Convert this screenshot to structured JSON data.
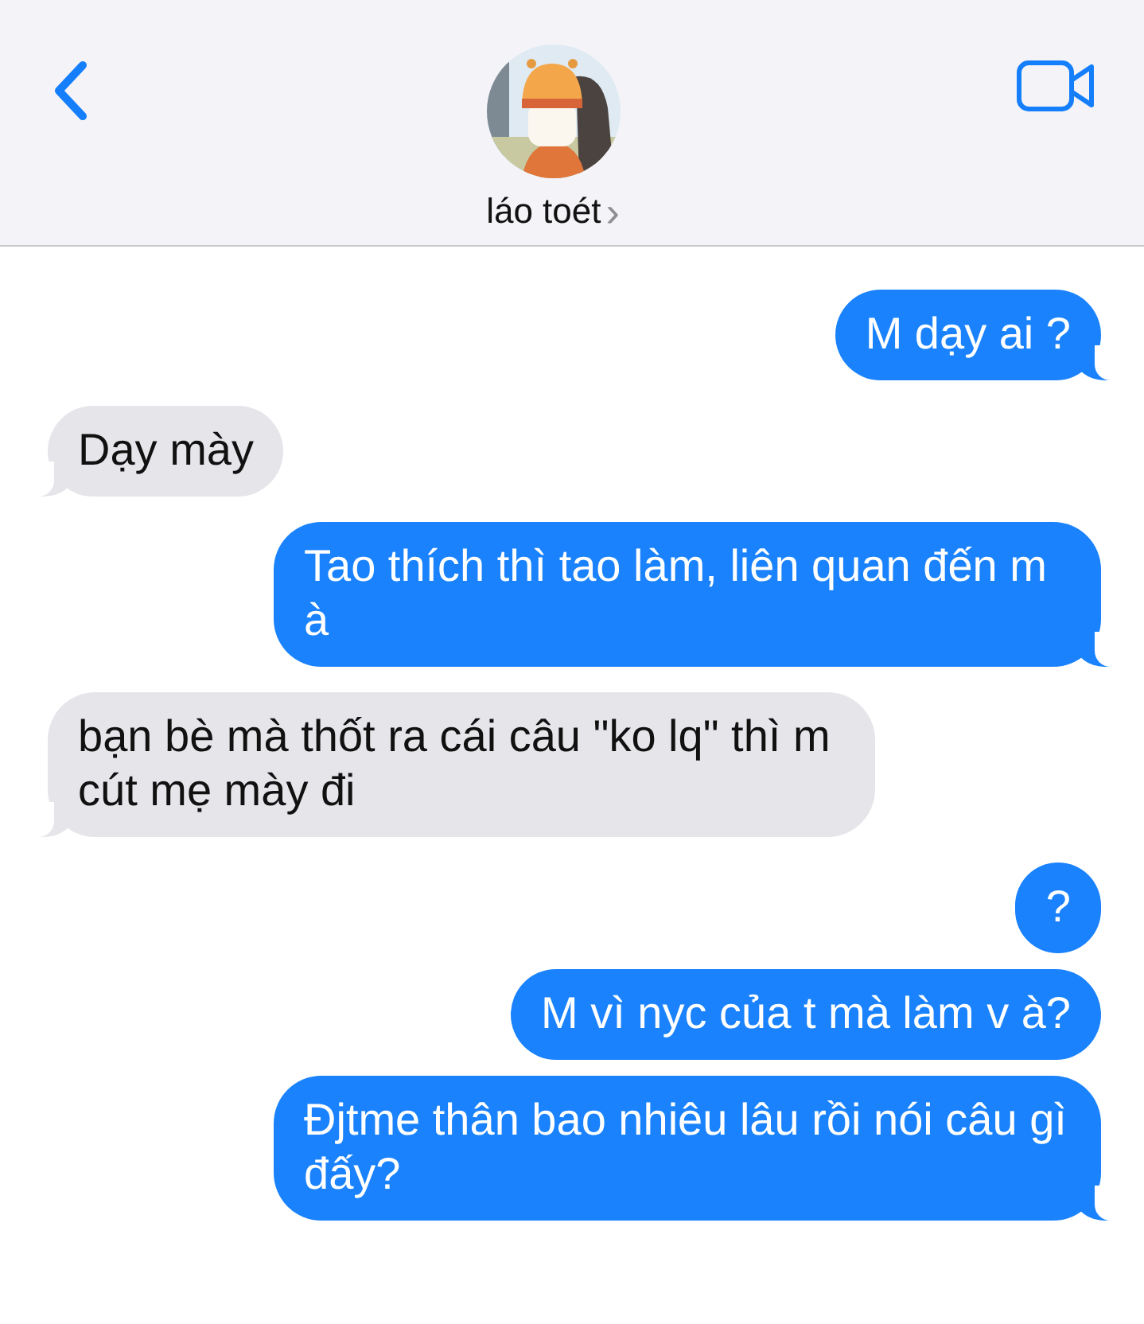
{
  "header": {
    "contact_name": "láo toét",
    "chevron": "›"
  },
  "messages": [
    {
      "kind": "sent",
      "text": "M dạy ai ?",
      "tail": true
    },
    {
      "kind": "received",
      "text": "Dạy mày",
      "tail": true
    },
    {
      "kind": "sent",
      "text": "Tao thích thì tao làm, liên quan đến m à",
      "tail": true
    },
    {
      "kind": "received",
      "text": "bạn bè mà thốt ra cái câu \"ko lq\" thì m cút mẹ mày đi",
      "tail": true
    },
    {
      "kind": "sent",
      "text": "?",
      "tail": false
    },
    {
      "kind": "sent",
      "text": "M vì nyc của t mà làm v à?",
      "tail": false
    },
    {
      "kind": "sent",
      "text": "Đjtme thân bao nhiêu lâu rồi nói câu gì đấy?",
      "tail": true
    }
  ]
}
